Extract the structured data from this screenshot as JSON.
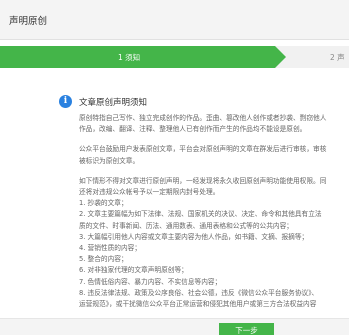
{
  "header": {
    "title": "声明原创"
  },
  "steps": [
    {
      "label": "1 须知"
    },
    {
      "label": "2 声"
    }
  ],
  "notice": {
    "title": "文章原创声明须知",
    "lines": [
      "原创特指自己写作、独立完成创作的作品。歪曲、篡改他人创作或者抄袭、剽窃他人",
      "作品，改编、翻译、注释、整理他人已有创作而产生的作品均不能设是原创。",
      "",
      "公众平台鼓励用户发表原创文章，平台会对原创声明的文章在群发后进行审核，审核",
      "被标识为原创文章。",
      "",
      "如下情形不得对文章进行原创声明，一经发现将永久收回原创声明功能使用权限。同",
      "还将对违规公众帐号予以一定期限内封号处理。",
      "1. 抄袭的文章；",
      "2. 文章主要篇幅为如下法律、法规、国家机关的决议、决定、命令和其他具有立法",
      "质的文件、时事新闻、历法、通用数表、通用表格和公式等的公共内容；",
      "3. 大篇幅引用他人内容或文章主要内容为他人作品，如书籍、文摘、报摘等；",
      "4. 营销性质的内容；",
      "5. 整合的内容；",
      "6. 对非独家代理的文章声明原创等；",
      "7. 色情低俗内容、暴力内容、不实信息等内容；",
      "8. 违反法律法规、政策及公序良俗、社会公德，违反《微信公众平台服务协议》、",
      "运营规范》，或干扰微信公众平台正常运营和侵犯其他用户或第三方合法权益内容"
    ]
  },
  "footer": {
    "next_label": "下一步"
  }
}
